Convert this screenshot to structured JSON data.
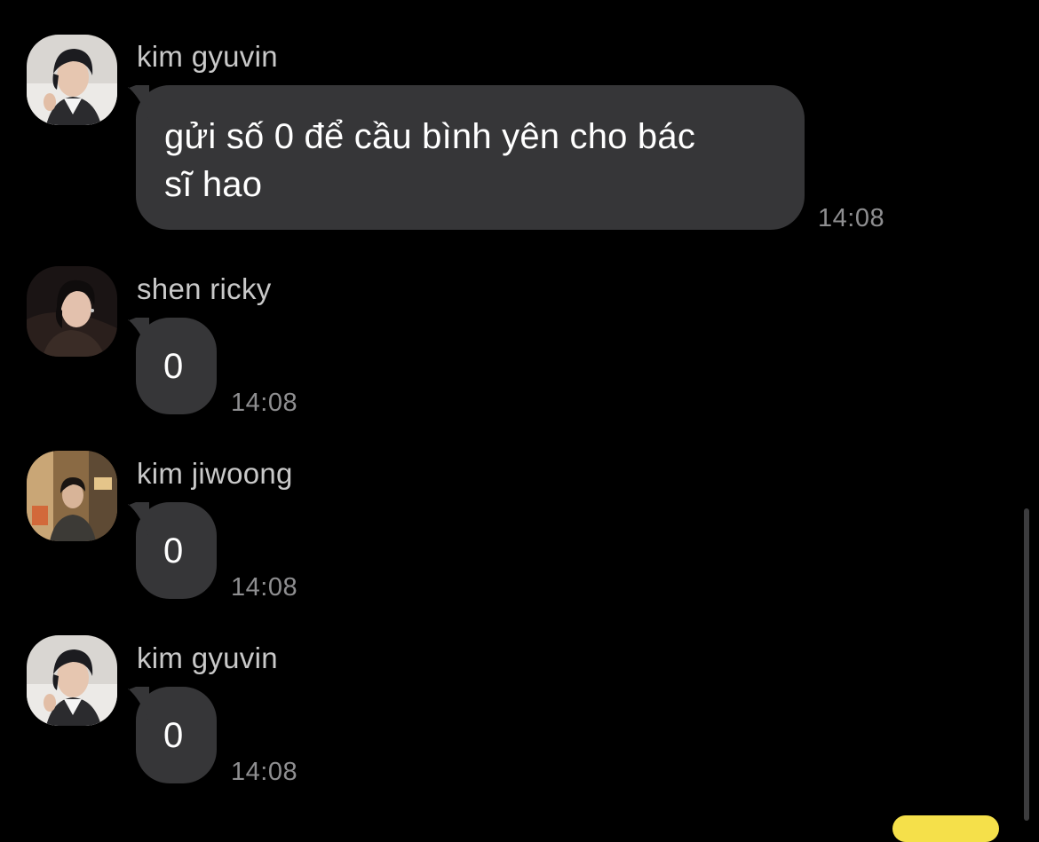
{
  "theme": {
    "background": "#000000",
    "bubble_color": "#363638",
    "sender_color": "#c9c9c9",
    "time_color": "#8e8e90",
    "own_bubble_color": "#f5e04a"
  },
  "messages": [
    {
      "sender": "kim gyuvin",
      "avatar_icon": "profile-photo",
      "text_lines": [
        "gửi số 0 để cầu bình yên cho bác",
        "sĩ hao"
      ],
      "time": "14:08"
    },
    {
      "sender": "shen ricky",
      "avatar_icon": "profile-photo",
      "text_lines": [
        "0"
      ],
      "time": "14:08"
    },
    {
      "sender": "kim jiwoong",
      "avatar_icon": "profile-photo",
      "text_lines": [
        "0"
      ],
      "time": "14:08"
    },
    {
      "sender": "kim gyuvin",
      "avatar_icon": "profile-photo",
      "text_lines": [
        "0"
      ],
      "time": "14:08"
    }
  ]
}
